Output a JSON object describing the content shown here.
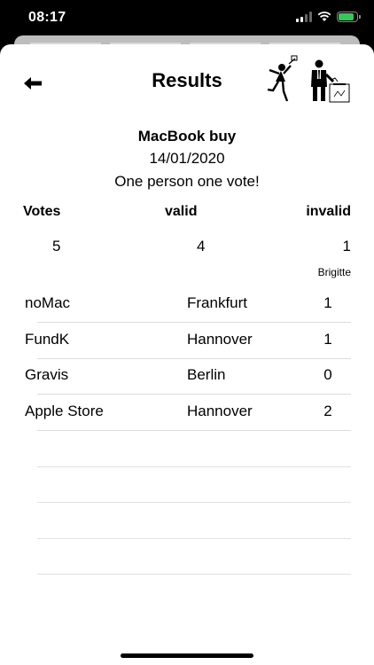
{
  "status_bar": {
    "time": "08:17"
  },
  "header": {
    "title": "Results",
    "back_icon": "arrow-left-icon",
    "logo_icon": "voting-figures-icon"
  },
  "poll": {
    "title": "MacBook buy",
    "date": "14/01/2020",
    "rule": "One person one vote!"
  },
  "summary": {
    "votes_label": "Votes",
    "valid_label": "valid",
    "invalid_label": "invalid",
    "votes": "5",
    "valid": "4",
    "invalid": "1",
    "invalid_name": "Brigitte"
  },
  "results": [
    {
      "name": "noMac",
      "city": "Frankfurt",
      "count": "1"
    },
    {
      "name": "FundK",
      "city": "Hannover",
      "count": "1"
    },
    {
      "name": "Gravis",
      "city": "Berlin",
      "count": "0"
    },
    {
      "name": "Apple Store",
      "city": "Hannover",
      "count": "2"
    }
  ],
  "colors": {
    "battery": "#34c759",
    "divider": "#dcdcdc"
  }
}
